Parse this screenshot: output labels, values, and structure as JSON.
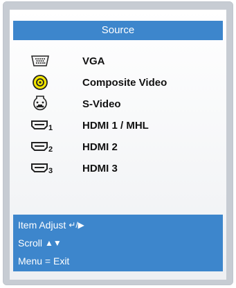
{
  "menu": {
    "title": "Source",
    "items": [
      {
        "label": "VGA",
        "icon": "vga-port-icon"
      },
      {
        "label": "Composite Video",
        "icon": "composite-video-port-icon"
      },
      {
        "label": "S-Video",
        "icon": "s-video-port-icon"
      },
      {
        "label": "HDMI 1 / MHL",
        "icon": "hdmi-port-icon",
        "sub": "1"
      },
      {
        "label": "HDMI 2",
        "icon": "hdmi-port-icon",
        "sub": "2"
      },
      {
        "label": "HDMI 3",
        "icon": "hdmi-port-icon",
        "sub": "3"
      }
    ]
  },
  "footer": {
    "item_adjust": "Item Adjust",
    "item_adjust_glyphs": "↵/▶",
    "scroll": "Scroll",
    "scroll_glyphs": "▲▼",
    "menu_exit": "Menu = Exit"
  },
  "colors": {
    "title_bar": "#3d86cc",
    "composite_icon": "#f2e600",
    "frame": "#c7ccd3"
  }
}
